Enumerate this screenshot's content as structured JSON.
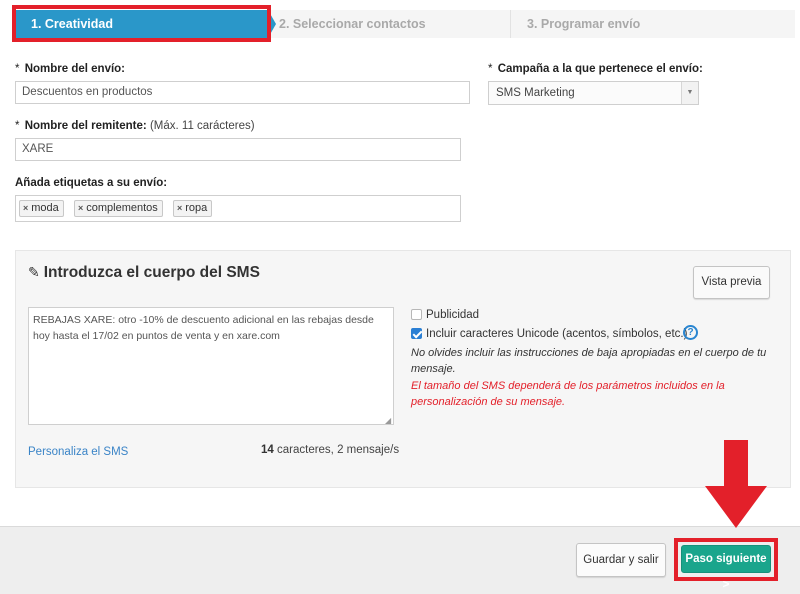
{
  "steps": [
    {
      "label": "1. Creatividad",
      "active": true
    },
    {
      "label": "2. Seleccionar contactos",
      "active": false
    },
    {
      "label": "3. Programar envío",
      "active": false
    }
  ],
  "form": {
    "required_mark": "*",
    "name_label": "Nombre del envío:",
    "name_value": "Descuentos en productos",
    "campaign_label": "Campaña a la que pertenece el envío:",
    "campaign_value": "SMS Marketing",
    "sender_label": "Nombre del remitente:",
    "sender_hint": "(Máx. 11 carácteres)",
    "sender_value": "XARE",
    "tags_label": "Añada etiquetas a su envío:",
    "tags": [
      "moda",
      "complementos",
      "ropa"
    ],
    "tag_remove_glyph": "×"
  },
  "sms": {
    "title": "Introduzca el cuerpo del SMS",
    "preview_button": "Vista previa",
    "body": "REBAJAS XARE: otro -10% de descuento adicional en las rebajas desde hoy hasta el 17/02 en puntos de venta y en xare.com",
    "publicidad_label": "Publicidad",
    "publicidad_checked": false,
    "unicode_label": "Incluir caracteres Unicode (acentos, símbolos, etc.)",
    "unicode_checked": true,
    "help_glyph": "?",
    "note_grey": "No olvides incluir las instrucciones de baja apropiadas en el cuerpo de tu mensaje.",
    "note_red": "El tamaño del SMS dependerá de los parámetros incluidos en la personalización de su mensaje.",
    "personalize_link": "Personaliza el SMS",
    "char_count": "14",
    "char_suffix": "caracteres, 2 mensaje/s"
  },
  "footer": {
    "save_button": "Guardar y salir",
    "next_button": "Paso siguiente >"
  },
  "colors": {
    "active_step": "#2a97c9",
    "highlight": "#e3202a",
    "next_button": "#1aa58c",
    "link": "#3a84c7"
  },
  "icons": {
    "edit": "pencil-square-icon",
    "dropdown": "caret-down-icon",
    "help": "question-circle-icon",
    "annotation": "red-down-arrow"
  }
}
